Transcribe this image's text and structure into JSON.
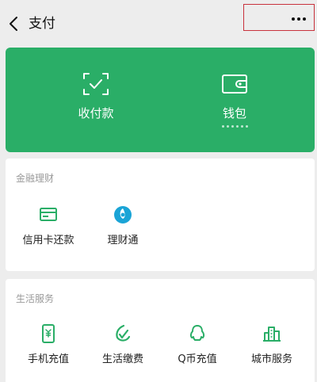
{
  "navbar": {
    "title": "支付",
    "back_icon": "chevron-left-icon",
    "more_icon": "more-dots-icon"
  },
  "wallet_card": {
    "background_color": "#2aae67",
    "items": [
      {
        "label": "收付款",
        "icon": "scan-check-icon"
      },
      {
        "label": "钱包",
        "icon": "wallet-icon"
      }
    ]
  },
  "finance_section": {
    "title": "金融理财",
    "items": [
      {
        "label": "信用卡还款",
        "icon": "credit-card-icon"
      },
      {
        "label": "理财通",
        "icon": "wealth-icon"
      }
    ]
  },
  "life_section": {
    "title": "生活服务",
    "items": [
      {
        "label": "手机充值",
        "icon": "phone-topup-icon"
      },
      {
        "label": "生活缴费",
        "icon": "utility-bill-icon"
      },
      {
        "label": "Q币充值",
        "icon": "qq-coin-icon"
      },
      {
        "label": "城市服务",
        "icon": "city-service-icon"
      }
    ]
  },
  "accent_color": "#2aae67"
}
